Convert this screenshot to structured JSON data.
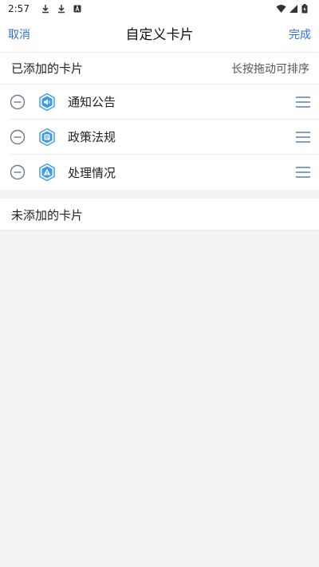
{
  "status_bar": {
    "time": "2:57",
    "icons": [
      "download-icon",
      "download-icon",
      "app-notification-icon",
      "wifi-icon",
      "cellular-signal-icon",
      "battery-icon"
    ]
  },
  "nav": {
    "cancel_label": "取消",
    "title": "自定义卡片",
    "done_label": "完成"
  },
  "added": {
    "title": "已添加的卡片",
    "hint": "长按拖动可排序",
    "cards": [
      {
        "label": "通知公告",
        "icon": "speaker-icon"
      },
      {
        "label": "政策法规",
        "icon": "document-icon"
      },
      {
        "label": "处理情况",
        "icon": "warning-icon"
      }
    ]
  },
  "unadded": {
    "title": "未添加的卡片"
  },
  "colors": {
    "accent": "#2f6fd0",
    "icon_blue": "#3a9be8",
    "remove_gray": "#6e7a8a",
    "handle_blue": "#5a7fb8",
    "background": "#f3f3f3"
  }
}
